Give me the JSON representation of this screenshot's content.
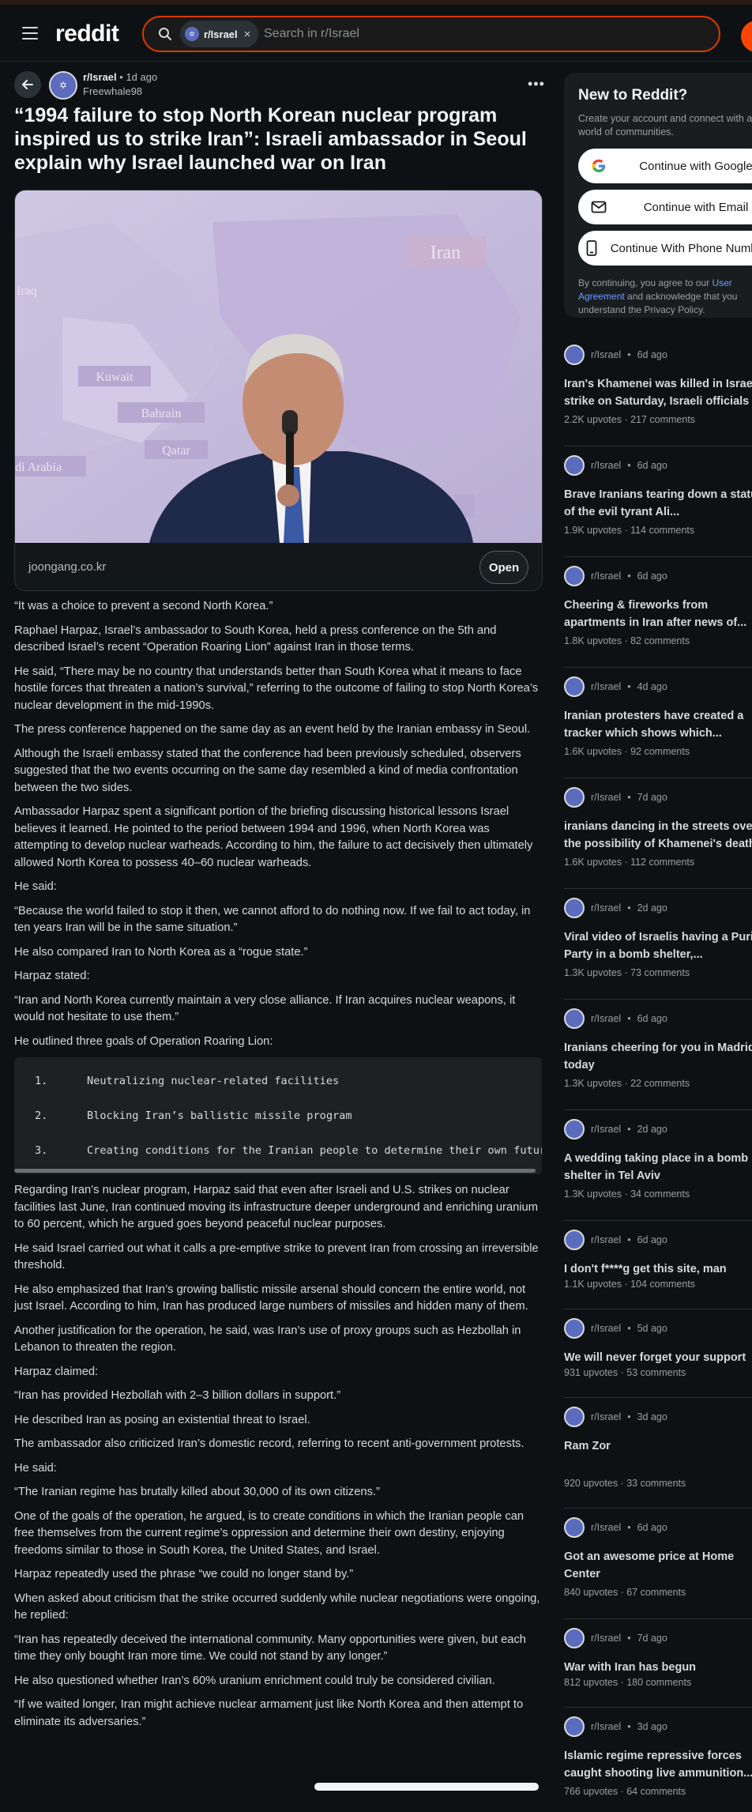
{
  "header": {
    "logo": "reddit",
    "search_chip": "r/Israel",
    "search_placeholder": "Search in r/Israel"
  },
  "post": {
    "subreddit": "r/Israel",
    "age": "1d ago",
    "author": "Freewhale98",
    "title": "“1994 failure to stop North Korean nuclear program inspired us to strike Iran”: Israeli ambassador in Seoul explain why Israel launched war on Iran",
    "link_domain": "joongang.co.kr",
    "open_label": "Open",
    "map_labels": [
      "Iran",
      "Iraq",
      "Kuwait",
      "Bahrain",
      "Qatar",
      "di Arabia"
    ]
  },
  "body": {
    "paragraphs_before": [
      "“It was a choice to prevent a second North Korea.”",
      "Raphael Harpaz, Israel’s ambassador to South Korea, held a press conference on the 5th and described Israel’s recent “Operation Roaring Lion” against Iran in those terms.",
      "He said, “There may be no country that understands better than South Korea what it means to face hostile forces that threaten a nation’s survival,” referring to the outcome of failing to stop North Korea’s nuclear development in the mid-1990s.",
      "The press conference happened on the same day as an event held by the Iranian embassy in Seoul.",
      "Although the Israeli embassy stated that the conference had been previously scheduled, observers suggested that the two events occurring on the same day resembled a kind of media confrontation between the two sides.",
      "Ambassador Harpaz spent a significant portion of the briefing discussing historical lessons Israel believes it learned. He pointed to the period between 1994 and 1996, when North Korea was attempting to develop nuclear warheads. According to him, the failure to act decisively then ultimately allowed North Korea to possess 40–60 nuclear warheads.",
      "He said:",
      "“Because the world failed to stop it then, we cannot afford to do nothing now. If we fail to act today, in ten years Iran will be in the same situation.”",
      "He also compared Iran to North Korea as a “rogue state.”",
      "Harpaz stated:",
      "“Iran and North Korea currently maintain a very close alliance. If Iran acquires nuclear weapons, it would not hesitate to use them.”",
      "He outlined three goals of Operation Roaring Lion:"
    ],
    "code_items": [
      {
        "num": "1.",
        "text": "Neutralizing nuclear-related facilities"
      },
      {
        "num": "2.",
        "text": "Blocking Iran’s ballistic missile program"
      },
      {
        "num": "3.",
        "text": "Creating conditions for the Iranian people to determine their own future"
      }
    ],
    "paragraphs_after": [
      "Regarding Iran’s nuclear program, Harpaz said that even after Israeli and U.S. strikes on nuclear facilities last June, Iran continued moving its infrastructure deeper underground and enriching uranium to 60 percent, which he argued goes beyond peaceful nuclear purposes.",
      "He said Israel carried out what it calls a pre-emptive strike to prevent Iran from crossing an irreversible threshold.",
      "He also emphasized that Iran’s growing ballistic missile arsenal should concern the entire world, not just Israel. According to him, Iran has produced large numbers of missiles and hidden many of them.",
      "Another justification for the operation, he said, was Iran’s use of proxy groups such as Hezbollah in Lebanon to threaten the region.",
      "Harpaz claimed:",
      "“Iran has provided Hezbollah with 2–3 billion dollars in support.”",
      "He described Iran as posing an existential threat to Israel.",
      "The ambassador also criticized Iran’s domestic record, referring to recent anti-government protests.",
      "He said:",
      "“The Iranian regime has brutally killed about 30,000 of its own citizens.”",
      "One of the goals of the operation, he argued, is to create conditions in which the Iranian people can free themselves from the current regime’s oppression and determine their own destiny, enjoying freedoms similar to those in South Korea, the United States, and Israel.",
      "Harpaz repeatedly used the phrase “we could no longer stand by.”",
      "When asked about criticism that the strike occurred suddenly while nuclear negotiations were ongoing, he replied:",
      "“Iran has repeatedly deceived the international community. Many opportunities were given, but each time they only bought Iran more time. We could not stand by any longer.”",
      "He also questioned whether Iran’s 60% uranium enrichment could truly be considered civilian.",
      "“If we waited longer, Iran might achieve nuclear armament just like North Korea and then attempt to eliminate its adversaries.”"
    ]
  },
  "signup": {
    "title": "New to Reddit?",
    "desc": "Create your account and connect with a world of communities.",
    "google_label": "Continue with Google",
    "email_label": "Continue with Email",
    "phone_label": "Continue With Phone Number",
    "terms_before": "By continuing, you agree to our ",
    "terms_link": "User Agreement",
    "terms_after": " and acknowledge that you understand the Privacy Policy."
  },
  "related": [
    {
      "sub": "r/Israel",
      "age": "6d ago",
      "title": "Iran's Khamenei was killed in Israeli strike on Saturday, Israeli officials confirm",
      "upvotes": "2.2K upvotes",
      "comments": "217 comments"
    },
    {
      "sub": "r/Israel",
      "age": "6d ago",
      "title": "Brave Iranians tearing down a statue of the evil tyrant Ali...",
      "upvotes": "1.9K upvotes",
      "comments": "114 comments"
    },
    {
      "sub": "r/Israel",
      "age": "6d ago",
      "title": "Cheering & fireworks from apartments in Iran after news of...",
      "upvotes": "1.8K upvotes",
      "comments": "82 comments"
    },
    {
      "sub": "r/Israel",
      "age": "4d ago",
      "title": "Iranian protesters have created a tracker which shows which...",
      "upvotes": "1.6K upvotes",
      "comments": "92 comments"
    },
    {
      "sub": "r/Israel",
      "age": "7d ago",
      "title": "iranians dancing in the streets over the possibility of Khamenei's death",
      "upvotes": "1.6K upvotes",
      "comments": "112 comments"
    },
    {
      "sub": "r/Israel",
      "age": "2d ago",
      "title": "Viral video of Israelis having a Purim Party in a bomb shelter,...",
      "upvotes": "1.3K upvotes",
      "comments": "73 comments"
    },
    {
      "sub": "r/Israel",
      "age": "6d ago",
      "title": "Iranians cheering for you in Madrid today",
      "upvotes": "1.3K upvotes",
      "comments": "22 comments"
    },
    {
      "sub": "r/Israel",
      "age": "2d ago",
      "title": "A wedding taking place in a bomb shelter in Tel Aviv",
      "upvotes": "1.3K upvotes",
      "comments": "34 comments"
    },
    {
      "sub": "r/Israel",
      "age": "6d ago",
      "title": "I don't f****g get this site, man",
      "upvotes": "1.1K upvotes",
      "comments": "104 comments"
    },
    {
      "sub": "r/Israel",
      "age": "5d ago",
      "title": "We will never forget your support",
      "upvotes": "931 upvotes",
      "comments": "53 comments"
    },
    {
      "sub": "r/Israel",
      "age": "3d ago",
      "title": "Ram Zor",
      "upvotes": "920 upvotes",
      "comments": "33 comments"
    },
    {
      "sub": "r/Israel",
      "age": "6d ago",
      "title": "Got an awesome price at Home Center",
      "upvotes": "840 upvotes",
      "comments": "67 comments"
    },
    {
      "sub": "r/Israel",
      "age": "7d ago",
      "title": "War with Iran has begun",
      "upvotes": "812 upvotes",
      "comments": "180 comments"
    },
    {
      "sub": "r/Israel",
      "age": "3d ago",
      "title": "Islamic regime repressive forces caught shooting live ammunition...",
      "upvotes": "766 upvotes",
      "comments": "64 comments"
    }
  ]
}
